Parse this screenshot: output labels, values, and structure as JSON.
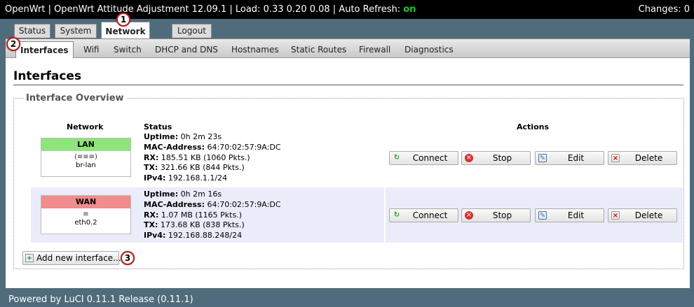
{
  "header": {
    "prefix": "OpenWrt | OpenWrt Attitude Adjustment 12.09.1 | Load: 0.33 0.20 0.08 | Auto Refresh: ",
    "auto_refresh_state": "on",
    "changes": "Changes: 0"
  },
  "top_tabs": [
    {
      "label": "Status"
    },
    {
      "label": "System"
    },
    {
      "label": "Network"
    },
    {
      "label": "Logout"
    }
  ],
  "sub_tabs": [
    {
      "label": "Interfaces"
    },
    {
      "label": "Wifi"
    },
    {
      "label": "Switch"
    },
    {
      "label": "DHCP and DNS"
    },
    {
      "label": "Hostnames"
    },
    {
      "label": "Static Routes"
    },
    {
      "label": "Firewall"
    },
    {
      "label": "Diagnostics"
    }
  ],
  "page_title": "Interfaces",
  "section_legend": "Interface Overview",
  "columns": {
    "network": "Network",
    "status": "Status",
    "actions": "Actions"
  },
  "interfaces": [
    {
      "name": "LAN",
      "color": "#90e47c",
      "icons": "(≡≡≡)",
      "device": "br-lan",
      "uptime_label": "Uptime:",
      "uptime": "0h 2m 23s",
      "mac_label": "MAC-Address:",
      "mac": "64:70:02:57:9A:DC",
      "rx_label": "RX:",
      "rx": "185.51 KB (1060 Pkts.)",
      "tx_label": "TX:",
      "tx": "321.66 KB (844 Pkts.)",
      "ipv4_label": "IPv4:",
      "ipv4": "192.168.1.1/24"
    },
    {
      "name": "WAN",
      "color": "#f08c8c",
      "icons": "≡",
      "device": "eth0.2",
      "uptime_label": "Uptime:",
      "uptime": "0h 2m 16s",
      "mac_label": "MAC-Address:",
      "mac": "64:70:02:57:9A:DC",
      "rx_label": "RX:",
      "rx": "1.07 MB (1165 Pkts.)",
      "tx_label": "TX:",
      "tx": "173.68 KB (838 Pkts.)",
      "ipv4_label": "IPv4:",
      "ipv4": "192.168.88.248/24"
    }
  ],
  "actions": {
    "connect": "Connect",
    "stop": "Stop",
    "edit": "Edit",
    "delete": "Delete"
  },
  "add_interface": "Add new interface...",
  "badges": [
    "1",
    "2",
    "3"
  ],
  "footer": "Powered by LuCI 0.11.1 Release (0.11.1)"
}
